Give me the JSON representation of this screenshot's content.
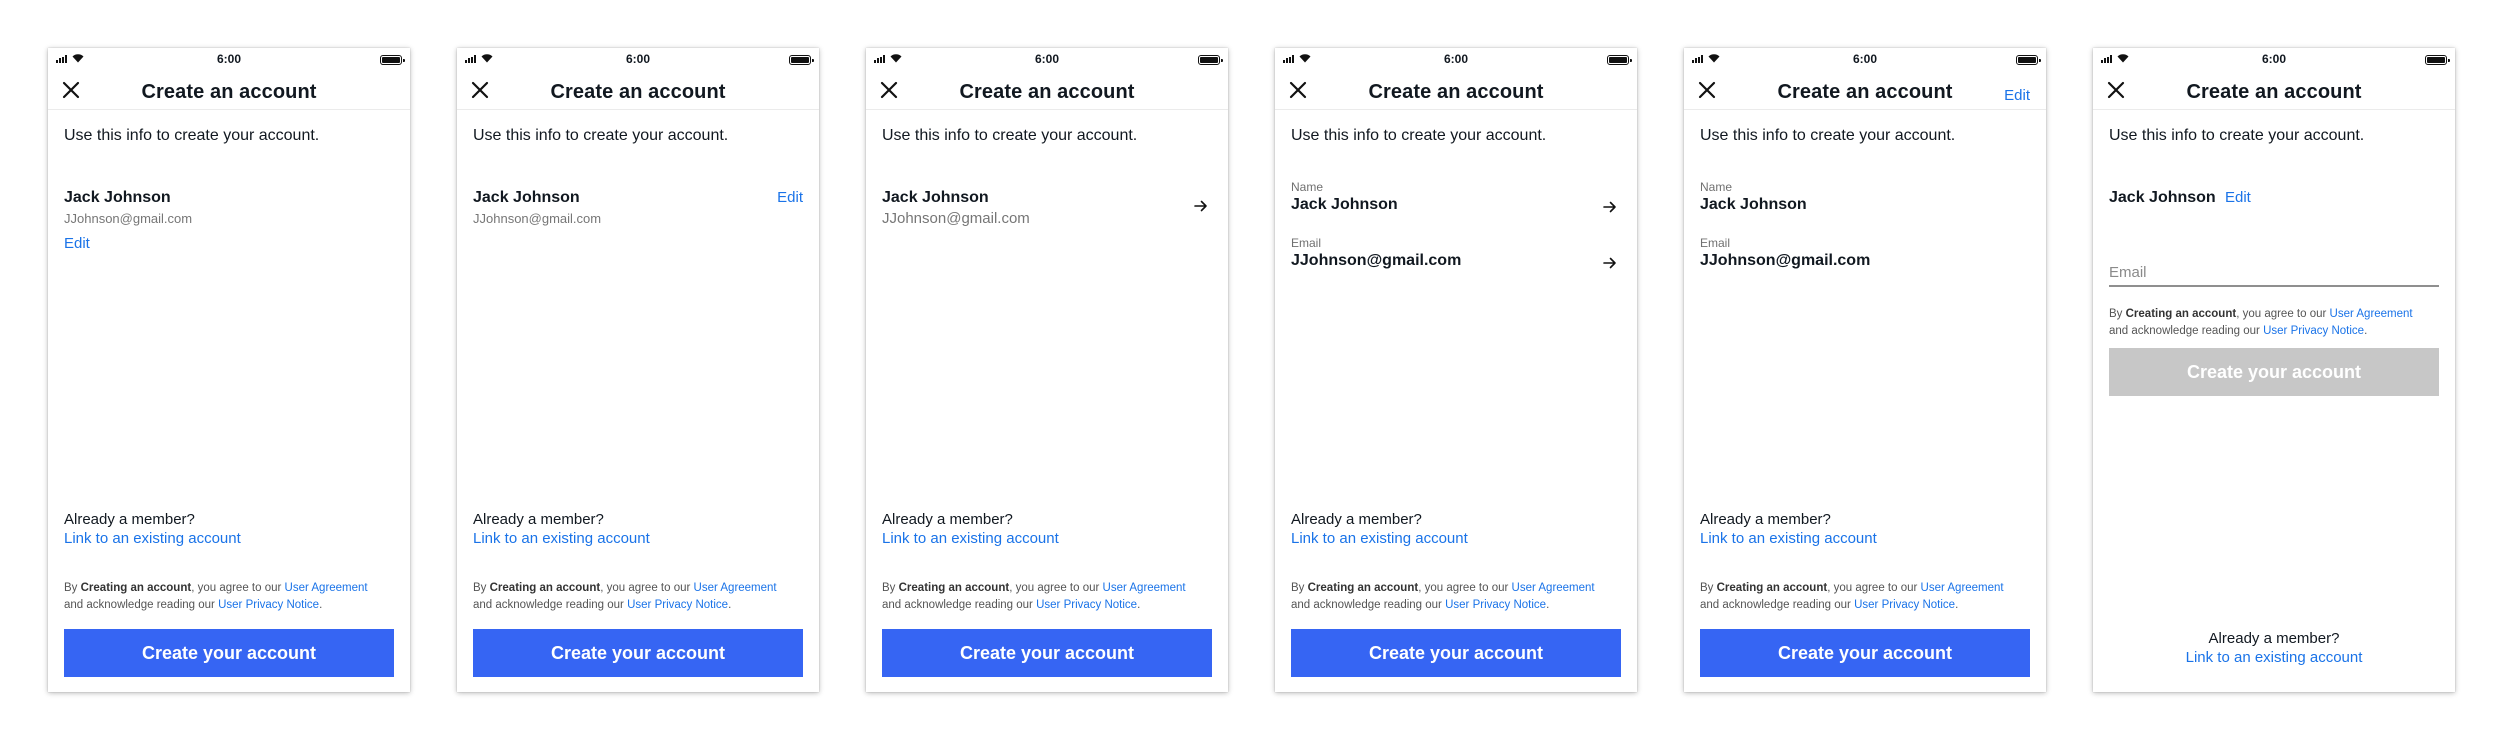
{
  "status_time": "6:00",
  "header": {
    "title": "Create an account",
    "edit_label": "Edit"
  },
  "intro": "Use this info to create your account.",
  "user": {
    "name": "Jack Johnson",
    "email": "JJohnson@gmail.com"
  },
  "fields": {
    "name_label": "Name",
    "email_label": "Email"
  },
  "edit_label": "Edit",
  "email_input": {
    "placeholder": "Email"
  },
  "member": {
    "prompt": "Already a member?",
    "link": "Link to an existing account"
  },
  "legal": {
    "by": "By ",
    "creating": "Creating an account",
    "agree": ", you agree to our ",
    "user_agreement": "User Agreement",
    "acknowledge": "and acknowledge reading our ",
    "privacy_notice": "User Privacy Notice",
    "period": "."
  },
  "cta": {
    "label": "Create your account"
  },
  "colors": {
    "primary": "#3665f3",
    "link": "#1a73e8",
    "disabled": "#c7c7c7"
  },
  "icons": [
    "signal-icon",
    "wifi-icon",
    "battery-icon",
    "close-icon",
    "arrow-right-icon"
  ]
}
